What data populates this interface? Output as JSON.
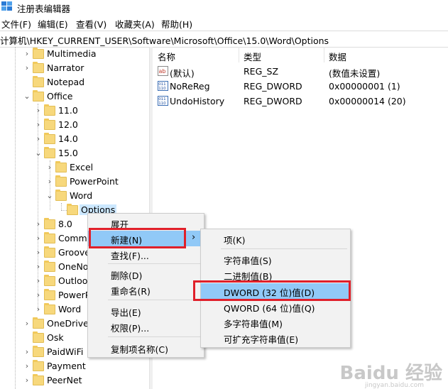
{
  "window": {
    "title": "注册表编辑器"
  },
  "menubar": [
    "文件(F)",
    "编辑(E)",
    "查看(V)",
    "收藏夹(A)",
    "帮助(H)"
  ],
  "address": "计算机\\HKEY_CURRENT_USER\\Software\\Microsoft\\Office\\15.0\\Word\\Options",
  "tree": {
    "nodes": [
      {
        "label": "Multimedia"
      },
      {
        "label": "Narrator"
      },
      {
        "label": "Notepad"
      },
      {
        "label": "Office"
      },
      {
        "label": "11.0"
      },
      {
        "label": "12.0"
      },
      {
        "label": "14.0"
      },
      {
        "label": "15.0"
      },
      {
        "label": "Excel"
      },
      {
        "label": "PowerPoint"
      },
      {
        "label": "Word"
      },
      {
        "label": "Options"
      },
      {
        "label": "8.0"
      },
      {
        "label": "Commo"
      },
      {
        "label": "Groove"
      },
      {
        "label": "OneNo"
      },
      {
        "label": "Outloo"
      },
      {
        "label": "PowerP"
      },
      {
        "label": "Word"
      },
      {
        "label": "OneDrive"
      },
      {
        "label": "Osk"
      },
      {
        "label": "PaidWiFi"
      },
      {
        "label": "Payment"
      },
      {
        "label": "PeerNet"
      }
    ]
  },
  "list": {
    "headers": {
      "name": "名称",
      "type": "类型",
      "data": "数据"
    },
    "rows": [
      {
        "name": "(默认)",
        "type": "REG_SZ",
        "data": "(数值未设置)",
        "icon": "string-value-icon"
      },
      {
        "name": "NoReReg",
        "type": "REG_DWORD",
        "data": "0x00000001 (1)",
        "icon": "binary-value-icon"
      },
      {
        "name": "UndoHistory",
        "type": "REG_DWORD",
        "data": "0x00000014 (20)",
        "icon": "binary-value-icon"
      }
    ]
  },
  "context_menu": {
    "items": [
      {
        "label": "展开"
      },
      {
        "label": "新建(N)"
      },
      {
        "label": "查找(F)..."
      },
      {
        "label": "删除(D)"
      },
      {
        "label": "重命名(R)"
      },
      {
        "label": "导出(E)"
      },
      {
        "label": "权限(P)..."
      },
      {
        "label": "复制项名称(C)"
      }
    ],
    "submenu_arrow": "›"
  },
  "submenu": {
    "items": [
      {
        "label": "项(K)"
      },
      {
        "label": "字符串值(S)"
      },
      {
        "label": "二进制值(B)"
      },
      {
        "label": "DWORD (32 位)值(D)"
      },
      {
        "label": "QWORD (64 位)值(Q)"
      },
      {
        "label": "多字符串值(M)"
      },
      {
        "label": "可扩充字符串值(E)"
      }
    ]
  },
  "icons": {
    "expanded": "⌄",
    "collapsed": "›"
  },
  "watermark": {
    "text": "Baidu 经验",
    "url": "jingyan.baidu.com"
  },
  "colors": {
    "highlight": "#91c9f7",
    "selection": "#cce8ff",
    "annotation_red": "#e0202a",
    "folder": "#f7d87c"
  }
}
